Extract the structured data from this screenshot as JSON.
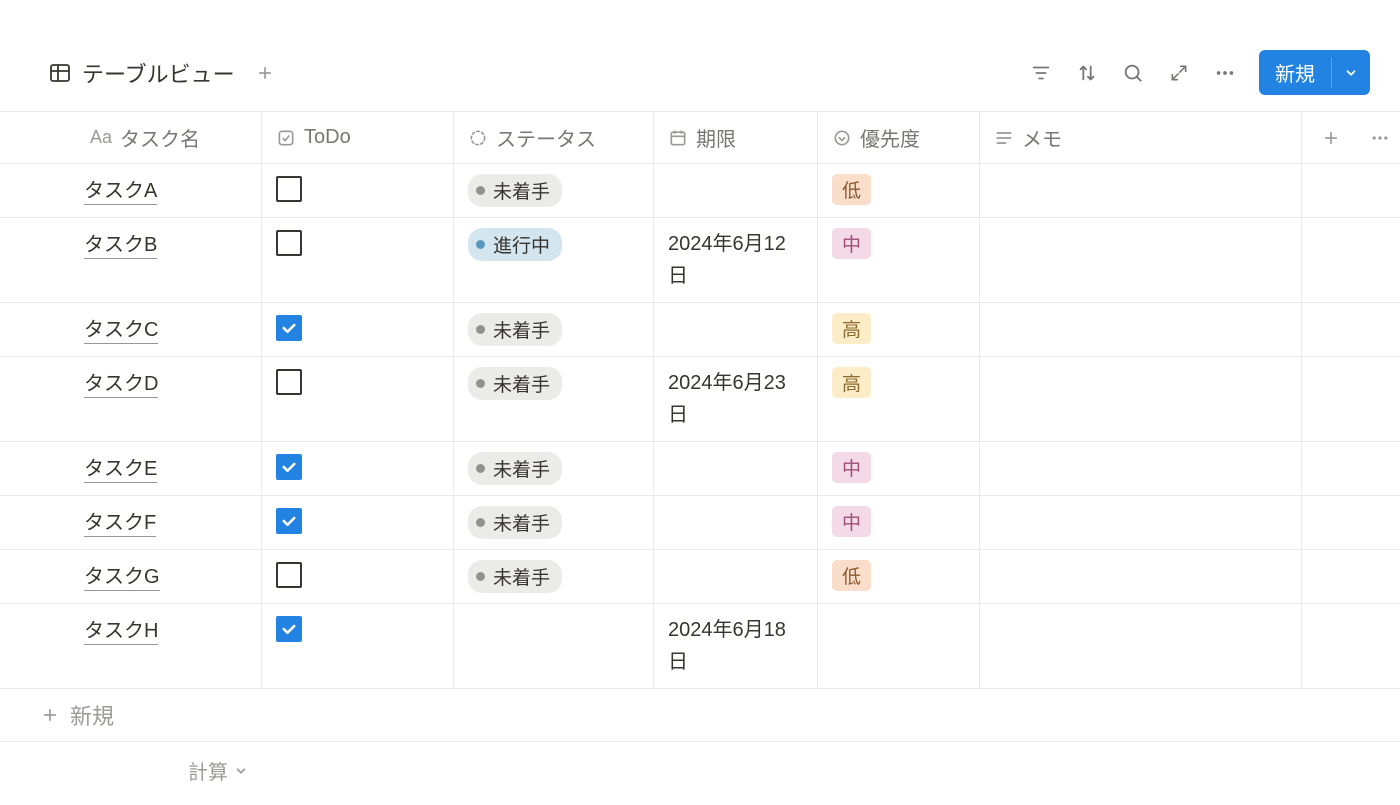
{
  "header": {
    "view_label": "テーブルビュー",
    "new_button": "新規"
  },
  "columns": {
    "name": "タスク名",
    "todo": "ToDo",
    "status": "ステータス",
    "deadline": "期限",
    "priority": "優先度",
    "memo": "メモ"
  },
  "status_labels": {
    "not_started": "未着手",
    "in_progress": "進行中"
  },
  "priority_labels": {
    "low": "低",
    "mid": "中",
    "high": "高"
  },
  "rows": [
    {
      "name": "タスクA",
      "checked": false,
      "status": "not_started",
      "deadline": "",
      "priority": "low"
    },
    {
      "name": "タスクB",
      "checked": false,
      "status": "in_progress",
      "deadline": "2024年6月12日",
      "priority": "mid"
    },
    {
      "name": "タスクC",
      "checked": true,
      "status": "not_started",
      "deadline": "",
      "priority": "high"
    },
    {
      "name": "タスクD",
      "checked": false,
      "status": "not_started",
      "deadline": "2024年6月23日",
      "priority": "high"
    },
    {
      "name": "タスクE",
      "checked": true,
      "status": "not_started",
      "deadline": "",
      "priority": "mid"
    },
    {
      "name": "タスクF",
      "checked": true,
      "status": "not_started",
      "deadline": "",
      "priority": "mid"
    },
    {
      "name": "タスクG",
      "checked": false,
      "status": "not_started",
      "deadline": "",
      "priority": "low"
    },
    {
      "name": "タスクH",
      "checked": true,
      "status": "",
      "deadline": "2024年6月18日",
      "priority": ""
    }
  ],
  "footer": {
    "add_new": "新規",
    "calc": "計算"
  }
}
